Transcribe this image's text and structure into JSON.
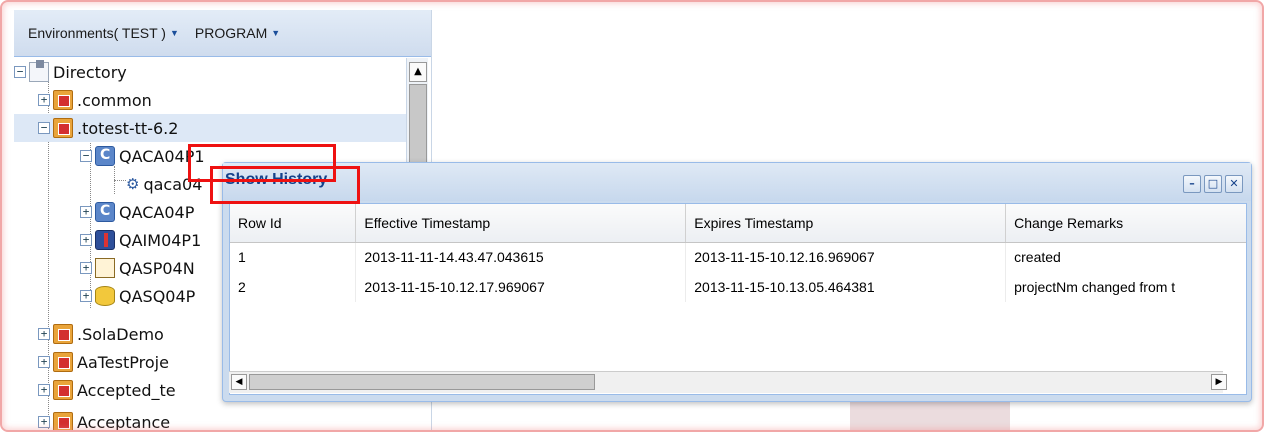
{
  "toolbar": {
    "environments_label": "Environments( TEST )",
    "program_label": "PROGRAM"
  },
  "tree": {
    "items": [
      {
        "label": "Directory",
        "icon": "directory-icon"
      },
      {
        "label": ".common",
        "icon": "folder-icon"
      },
      {
        "label": ".totest-tt-6.2",
        "icon": "folder-icon"
      },
      {
        "label": "QACA04P1",
        "icon": "program-icon"
      },
      {
        "label": "qaca04",
        "icon": "gear-icon"
      },
      {
        "label": "QACA04P",
        "icon": "program-icon"
      },
      {
        "label": "QAIM04P1",
        "icon": "im-icon"
      },
      {
        "label": "QASP04N",
        "icon": "sp-icon"
      },
      {
        "label": "QASQ04P",
        "icon": "sq-icon"
      },
      {
        "label": ".SolaDemo",
        "icon": "folder-icon"
      },
      {
        "label": "AaTestProje",
        "icon": "folder-icon"
      },
      {
        "label": "Accepted_te",
        "icon": "folder-icon"
      },
      {
        "label": "Acceptance",
        "icon": "folder-icon"
      }
    ]
  },
  "window": {
    "title": "Show History",
    "tools": {
      "minimize": "–",
      "maximize": "□",
      "close": "✕"
    },
    "columns": [
      "Row Id",
      "Effective Timestamp",
      "Expires Timestamp",
      "Change Remarks"
    ],
    "rows": [
      [
        "1",
        "2013-11-11-14.43.47.043615",
        "2013-11-15-10.12.16.969067",
        "created"
      ],
      [
        "2",
        "2013-11-15-10.12.17.969067",
        "2013-11-15-10.13.05.464381",
        "projectNm changed from t"
      ]
    ]
  },
  "colors": {
    "accent": "#15428b",
    "highlight_box": "#ee1111",
    "selection": "#dde8f6"
  }
}
